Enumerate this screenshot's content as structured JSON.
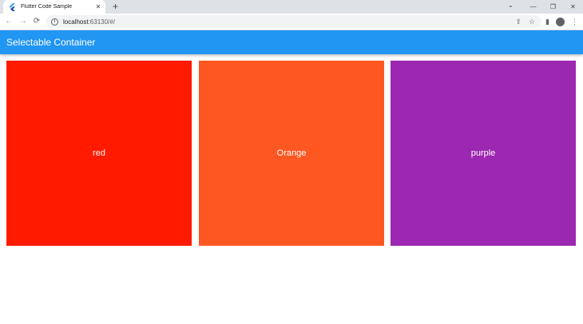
{
  "browser": {
    "tab": {
      "title": "Flutter Code Sample",
      "favicon": "flutter-logo-icon",
      "close_glyph": "✕"
    },
    "new_tab_glyph": "+",
    "tab_search_glyph": "⌄",
    "window_controls": {
      "minimize": "—",
      "restore": "❐",
      "close": "✕"
    },
    "nav": {
      "back": "←",
      "forward": "→",
      "reload": "⟳"
    },
    "address": {
      "host": "localhost",
      "port_path": ":63130/#/"
    },
    "omnibox_icons": {
      "share": "⇪",
      "star": "☆"
    },
    "toolbar_icons": {
      "side_panel": "▮",
      "menu": "⋮"
    }
  },
  "app": {
    "title": "Selectable Container",
    "appbar_color": "#2196f3",
    "tiles": [
      {
        "label": "red",
        "color": "#ff1a00"
      },
      {
        "label": "Orange",
        "color": "#ff5722"
      },
      {
        "label": "purple",
        "color": "#9c27b0"
      }
    ]
  }
}
